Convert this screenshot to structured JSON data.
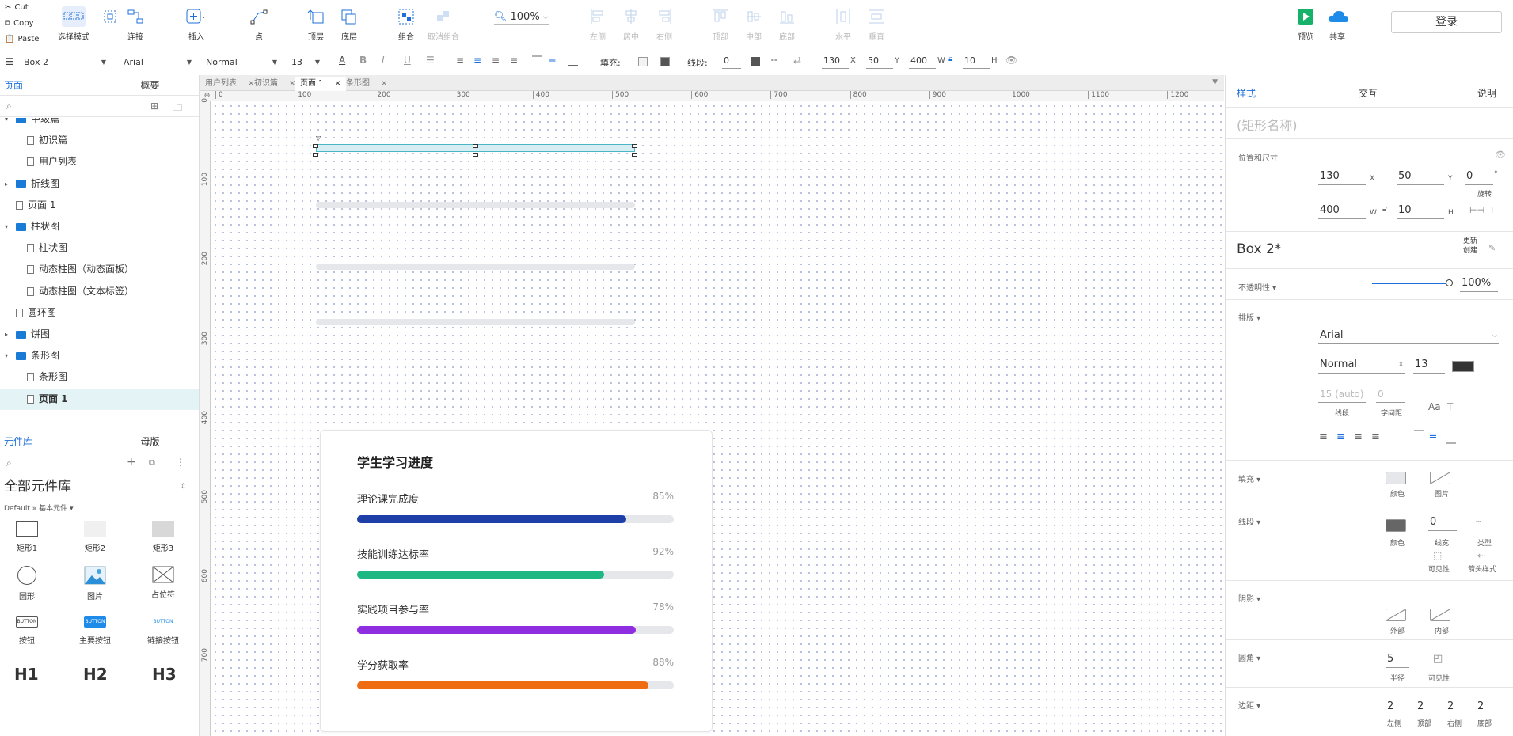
{
  "clipboard": {
    "cut": "Cut",
    "copy": "Copy",
    "paste": "Paste"
  },
  "toolbar": {
    "select_mode": "选择模式",
    "connect": "连接",
    "insert": "插入",
    "point": "点",
    "top": "顶层",
    "bottom": "底层",
    "group": "组合",
    "ungroup": "取消组合",
    "zoom": "100%",
    "align_left": "左侧",
    "align_center": "居中",
    "align_right": "右侧",
    "align_top": "顶部",
    "align_middle": "中部",
    "align_bottom": "底部",
    "dist_h": "水平",
    "dist_v": "垂直",
    "preview": "预览",
    "share": "共享",
    "login": "登录"
  },
  "format_bar": {
    "element": "Box 2",
    "font": "Arial",
    "weight": "Normal",
    "size": "13",
    "fill_label": "填充:",
    "line_label": "线段:",
    "line_width": "0",
    "x": "130",
    "x_lbl": "X",
    "y": "50",
    "y_lbl": "Y",
    "w": "400",
    "w_lbl": "W",
    "h": "10",
    "h_lbl": "H"
  },
  "pages_panel": {
    "tab_pages": "页面",
    "tab_outline": "概要",
    "items": [
      {
        "label": "中级篇",
        "type": "folder",
        "expanded": true
      },
      {
        "label": "初识篇",
        "type": "page"
      },
      {
        "label": "用户列表",
        "type": "page"
      },
      {
        "label": "折线图",
        "type": "folder",
        "expanded": false
      },
      {
        "label": "页面 1",
        "type": "page"
      },
      {
        "label": "柱状图",
        "type": "folder",
        "expanded": true
      },
      {
        "label": "柱状图",
        "type": "page"
      },
      {
        "label": "动态柱图（动态面板）",
        "type": "page"
      },
      {
        "label": "动态柱图（文本标签）",
        "type": "page"
      },
      {
        "label": "圆环图",
        "type": "page"
      },
      {
        "label": "饼图",
        "type": "folder",
        "expanded": false
      },
      {
        "label": "条形图",
        "type": "folder",
        "expanded": true
      },
      {
        "label": "条形图",
        "type": "page"
      },
      {
        "label": "页面 1",
        "type": "page",
        "selected": true
      }
    ]
  },
  "library_panel": {
    "tab_library": "元件库",
    "tab_masters": "母版",
    "library_name": "全部元件库",
    "breadcrumb": "Default » 基本元件 ▾",
    "items": [
      "矩形1",
      "矩形2",
      "矩形3",
      "圆形",
      "图片",
      "占位符",
      "按钮",
      "主要按钮",
      "链接按钮"
    ],
    "button_text": "BUTTON",
    "headings": [
      "H1",
      "H2",
      "H3"
    ]
  },
  "tabs": [
    "用户列表",
    "初识篇",
    "页面 1",
    "条形图"
  ],
  "active_tab": 2,
  "ruler": {
    "top": [
      "0",
      "100",
      "200",
      "300",
      "400",
      "500",
      "600",
      "700",
      "800",
      "900",
      "1000",
      "1100",
      "1200"
    ],
    "left": [
      "0",
      "100",
      "200",
      "300",
      "400",
      "500",
      "600",
      "700"
    ]
  },
  "card": {
    "title": "学生学习进度",
    "rows": [
      {
        "label": "理论课完成度",
        "value": "85%",
        "pct": 85,
        "color": "#1f3fa8"
      },
      {
        "label": "技能训练达标率",
        "value": "92%",
        "pct": 78,
        "color": "#1fb882"
      },
      {
        "label": "实践项目参与率",
        "value": "78%",
        "pct": 88,
        "color": "#8e2ee0"
      },
      {
        "label": "学分获取率",
        "value": "88%",
        "pct": 92,
        "color": "#f06c12"
      }
    ]
  },
  "inspector": {
    "tab_style": "样式",
    "tab_interact": "交互",
    "tab_notes": "说明",
    "name_placeholder": "(矩形名称)",
    "pos_size": "位置和尺寸",
    "x": "130",
    "y": "50",
    "rot": "0",
    "w": "400",
    "h": "10",
    "lbl_x": "X",
    "lbl_y": "Y",
    "lbl_w": "W",
    "lbl_h": "H",
    "lbl_rot": "旋转",
    "style_name": "Box 2*",
    "update": "更新",
    "create": "创建",
    "opacity_lbl": "不透明性 ▾",
    "opacity": "100%",
    "typo_lbl": "排版 ▾",
    "font": "Arial",
    "weight": "Normal",
    "size": "13",
    "line_h": "15 (auto)",
    "letter": "0",
    "lbl_line": "线段",
    "lbl_letter": "字间距",
    "fill_lbl": "填充 ▾",
    "lbl_color": "颜色",
    "lbl_image": "图片",
    "stroke_lbl": "线段 ▾",
    "stroke_w": "0",
    "lbl_width": "线宽",
    "lbl_type": "类型",
    "lbl_visible": "可见性",
    "lbl_arrow": "箭头样式",
    "shadow_lbl": "阴影 ▾",
    "lbl_outer": "外部",
    "lbl_inner": "内部",
    "corner_lbl": "圆角 ▾",
    "radius": "5",
    "lbl_radius": "半径",
    "padding_lbl": "边距 ▾",
    "pad": [
      "2",
      "2",
      "2",
      "2"
    ],
    "pad_lbls": [
      "左侧",
      "顶部",
      "右侧",
      "底部"
    ]
  }
}
